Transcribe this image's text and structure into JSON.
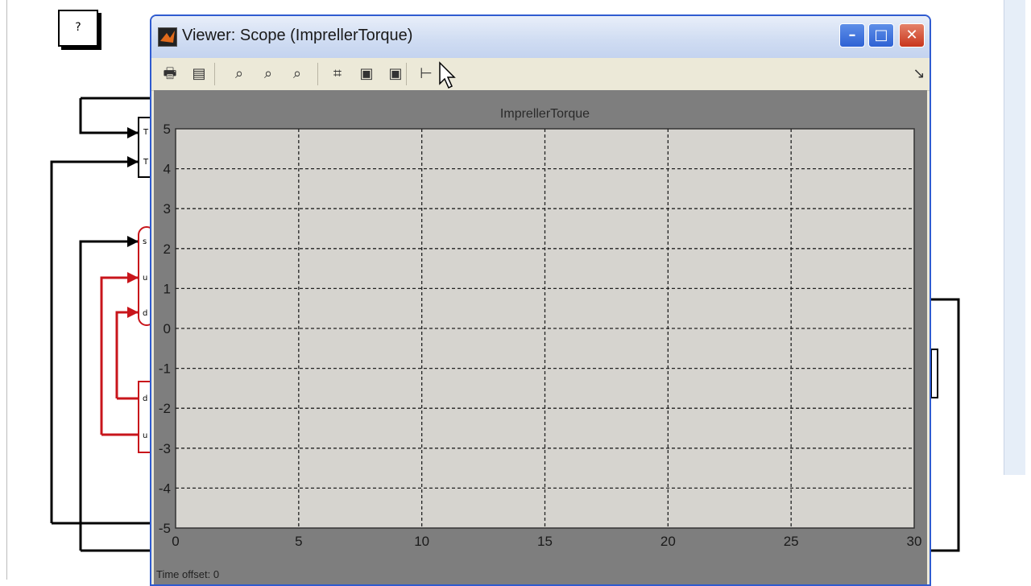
{
  "help_block": {
    "label": "?"
  },
  "viewer": {
    "title": "Viewer: Scope (ImprellerTorque)",
    "window_buttons": {
      "minimize": "–",
      "maximize": "□",
      "close": "✕"
    },
    "toolbar": {
      "items": [
        {
          "name": "print-button",
          "icon": "printer-icon",
          "glyph": "🖶"
        },
        {
          "name": "params-button",
          "icon": "parameters-icon",
          "glyph": "▤"
        },
        {
          "name": "zoom-button",
          "icon": "zoom-icon",
          "glyph": "⌕"
        },
        {
          "name": "zoom-x-button",
          "icon": "zoom-x-icon",
          "glyph": "⌕"
        },
        {
          "name": "zoom-y-button",
          "icon": "zoom-y-icon",
          "glyph": "⌕"
        },
        {
          "name": "autoscale-button",
          "icon": "binoculars-icon",
          "glyph": "⌗"
        },
        {
          "name": "save-axes-button",
          "icon": "save-axes-icon",
          "glyph": "▣"
        },
        {
          "name": "restore-axes-button",
          "icon": "restore-axes-icon",
          "glyph": "▣"
        },
        {
          "name": "signal-select-button",
          "icon": "signal-select-icon",
          "glyph": "⊢"
        }
      ],
      "dock_icon": "↘"
    },
    "status": {
      "time_offset_label": "Time offset:",
      "time_offset_value": "0"
    }
  },
  "colors": {
    "plot_bg": "#d6d4cf",
    "frame": "#7e7e7e",
    "grid": "#222222"
  },
  "chart_data": {
    "type": "line",
    "title": "ImprellerTorque",
    "xlabel": "",
    "ylabel": "",
    "xlim": [
      0,
      30
    ],
    "ylim": [
      -5,
      5
    ],
    "x_ticks": [
      0,
      5,
      10,
      15,
      20,
      25,
      30
    ],
    "y_ticks": [
      5,
      4,
      3,
      2,
      1,
      0,
      -1,
      -2,
      -3,
      -4,
      -5
    ],
    "grid": true,
    "series": []
  }
}
